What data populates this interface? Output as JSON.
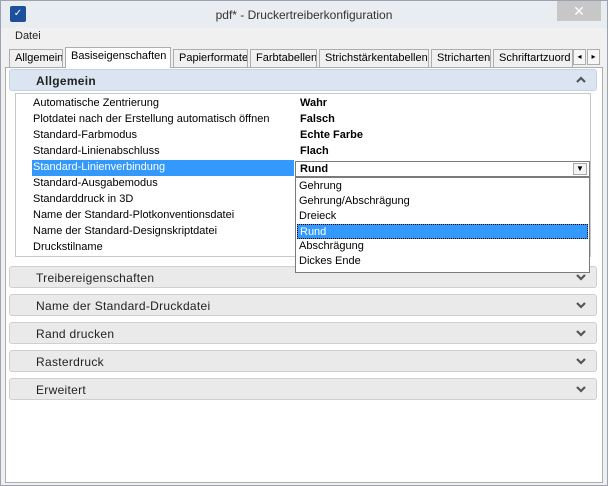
{
  "window": {
    "title": "pdf* - Druckertreiberkonfiguration",
    "icon": "plotter-app-icon",
    "close_glyph": "✕"
  },
  "menu": {
    "items": [
      "Datei"
    ]
  },
  "tabs": [
    "Allgemein",
    "Basiseigenschaften",
    "Papierformate",
    "Farbtabellen",
    "Strichstärkentabellen",
    "Stricharten",
    "Schriftartzuord"
  ],
  "active_tab": "Basiseigenschaften",
  "tab_scroll": {
    "left": "◂",
    "right": "▸"
  },
  "sections": {
    "allgemein": "Allgemein",
    "treiber": "Treibereigenschaften",
    "druckdatei": "Name der Standard-Druckdatei",
    "rand": "Rand drucken",
    "raster": "Rasterdruck",
    "erweitert": "Erweitert"
  },
  "properties": [
    {
      "name": "Automatische Zentrierung",
      "value": "Wahr"
    },
    {
      "name": "Plotdatei nach der Erstellung automatisch öffnen",
      "value": "Falsch"
    },
    {
      "name": "Standard-Farbmodus",
      "value": "Echte Farbe"
    },
    {
      "name": "Standard-Linienabschluss",
      "value": "Flach"
    },
    {
      "name": "Standard-Linienverbindung",
      "value": "Rund"
    },
    {
      "name": "Standard-Ausgabemodus",
      "value": ""
    },
    {
      "name": "Standarddruck in 3D",
      "value": ""
    },
    {
      "name": "Name der Standard-Plotkonventionsdatei",
      "value": ""
    },
    {
      "name": "Name der Standard-Designskriptdatei",
      "value": ""
    },
    {
      "name": "Druckstilname",
      "value": ""
    }
  ],
  "dropdown": {
    "selected": "Rund",
    "options": [
      "Gehrung",
      "Gehrung/Abschrägung",
      "Dreieck",
      "Rund",
      "Abschrägung",
      "Dickes Ende"
    ]
  },
  "colors": {
    "selection": "#3399ff",
    "header_expanded": "#dbe5f1"
  }
}
